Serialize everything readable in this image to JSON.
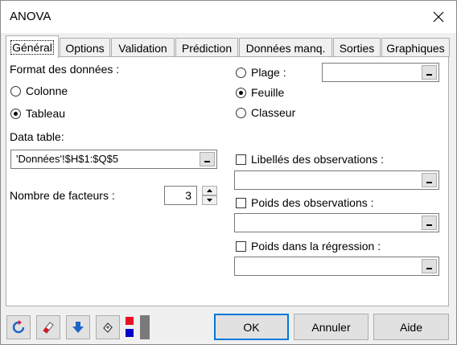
{
  "window": {
    "title": "ANOVA"
  },
  "tabs": [
    {
      "label": "Général",
      "active": true
    },
    {
      "label": "Options"
    },
    {
      "label": "Validation"
    },
    {
      "label": "Prédiction"
    },
    {
      "label": "Données manq."
    },
    {
      "label": "Sorties"
    },
    {
      "label": "Graphiques"
    }
  ],
  "general": {
    "format_label": "Format des données :",
    "format_options": [
      {
        "label": "Colonne",
        "selected": false
      },
      {
        "label": "Tableau",
        "selected": true
      }
    ],
    "data_table_label": "Data table:",
    "data_table_value": "'Données'!$H$1:$Q$5",
    "factors_label": "Nombre de facteurs :",
    "factors_value": "3",
    "output_options": [
      {
        "label": "Plage :",
        "selected": false
      },
      {
        "label": "Feuille",
        "selected": true
      },
      {
        "label": "Classeur",
        "selected": false
      }
    ],
    "range_value": "",
    "obs_labels": {
      "label": "Libellés des observations :",
      "checked": false,
      "value": ""
    },
    "obs_weights": {
      "label": "Poids des observations :",
      "checked": false,
      "value": ""
    },
    "reg_weights": {
      "label": "Poids dans la régression :",
      "checked": false,
      "value": ""
    }
  },
  "toolbar_icons": [
    "reset-icon",
    "eraser-icon",
    "download-icon",
    "help-cursor-icon",
    "color-swatch-icon"
  ],
  "buttons": {
    "ok": "OK",
    "cancel": "Annuler",
    "help": "Aide"
  },
  "colors": {
    "accent": "#0078d7",
    "arrow": "#1e64c8",
    "red": "#e81123",
    "blue": "#0000c8"
  }
}
